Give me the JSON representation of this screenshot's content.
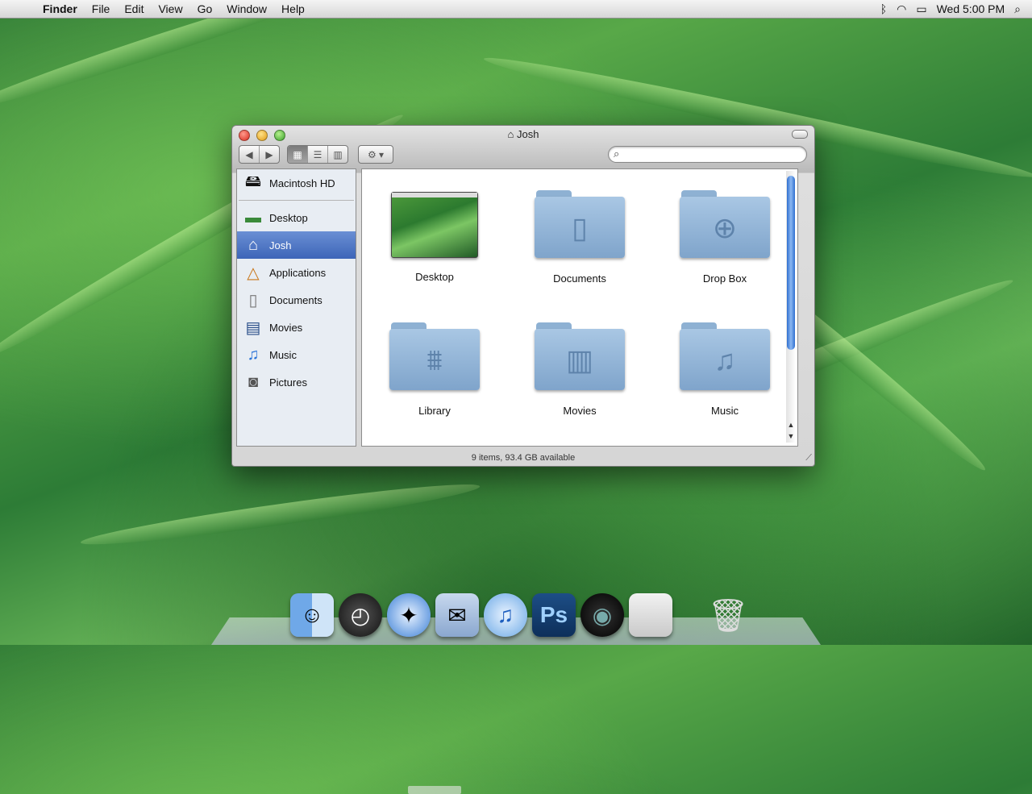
{
  "menubar": {
    "apple_icon": "apple-icon",
    "app_name": "Finder",
    "menus": [
      "File",
      "Edit",
      "View",
      "Go",
      "Window",
      "Help"
    ],
    "clock": "Wed 5:00 PM",
    "status_icons": [
      "bluetooth-icon",
      "wifi-icon",
      "battery-icon",
      "spotlight-icon"
    ]
  },
  "window": {
    "title": "Josh",
    "status": "9 items, 93.4 GB available",
    "search_placeholder": "",
    "sidebar": {
      "devices": [
        {
          "label": "Macintosh HD",
          "icon": "hard-disk-icon"
        }
      ],
      "places": [
        {
          "label": "Desktop",
          "icon": "desktop-icon",
          "selected": false
        },
        {
          "label": "Josh",
          "icon": "home-icon",
          "selected": true
        },
        {
          "label": "Applications",
          "icon": "applications-icon",
          "selected": false
        },
        {
          "label": "Documents",
          "icon": "documents-icon",
          "selected": false
        },
        {
          "label": "Movies",
          "icon": "movies-icon",
          "selected": false
        },
        {
          "label": "Music",
          "icon": "music-icon",
          "selected": false
        },
        {
          "label": "Pictures",
          "icon": "pictures-icon",
          "selected": false
        }
      ]
    },
    "items": [
      {
        "label": "Desktop",
        "icon": "desktop-thumbnail"
      },
      {
        "label": "Documents",
        "icon": "documents-folder-icon"
      },
      {
        "label": "Drop Box",
        "icon": "dropbox-folder-icon"
      },
      {
        "label": "Library",
        "icon": "library-folder-icon"
      },
      {
        "label": "Movies",
        "icon": "movies-folder-icon"
      },
      {
        "label": "Music",
        "icon": "music-folder-icon"
      }
    ]
  },
  "dock": {
    "apps": [
      "finder-icon",
      "dashboard-icon",
      "safari-icon",
      "mail-icon",
      "itunes-icon",
      "photoshop-icon",
      "camera-icon",
      "system-preferences-icon",
      "trash-icon"
    ],
    "photoshop_label": "Ps"
  }
}
